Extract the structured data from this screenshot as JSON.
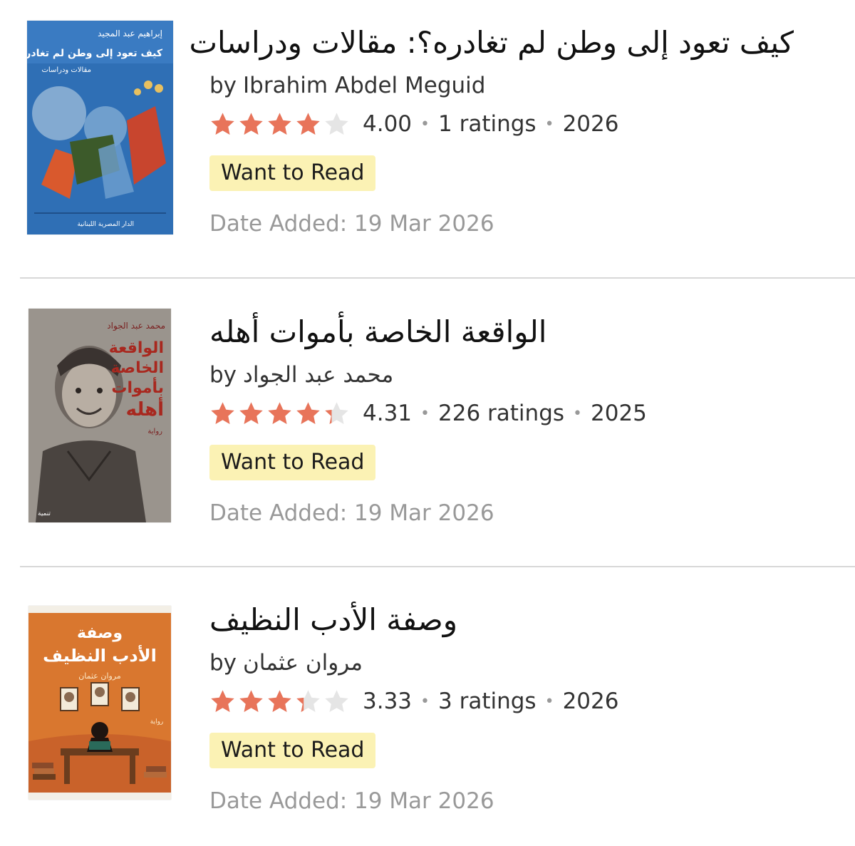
{
  "books": [
    {
      "title": "كيف تعود إلى وطن لم تغادره؟: مقالات ودراسات",
      "by_label": "by",
      "author": "Ibrahim Abdel Meguid",
      "rating": 4.0,
      "average": "4.00",
      "ratings_count": "1 ratings",
      "year": "2026",
      "shelf_button": "Want to Read",
      "date_added": "Date Added: 19 Mar 2026",
      "cover": {
        "top_text": "إبراهيم عبد المجيد",
        "title_text": "كيف تعود إلى وطن لم تغادره؟",
        "subtitle_text": "مقالات ودراسات",
        "publisher_text": "الدار المصرية اللبنانية",
        "bg_color": "#2f6fb5"
      }
    },
    {
      "title": "الواقعة الخاصة بأموات أهله",
      "by_label": "by",
      "author": "محمد عبد الجواد",
      "rating": 4.31,
      "average": "4.31",
      "ratings_count": "226 ratings",
      "year": "2025",
      "shelf_button": "Want to Read",
      "date_added": "Date Added: 19 Mar 2026",
      "cover": {
        "top_text": "محمد عبد الجواد",
        "title_line1": "الواقعة",
        "title_line2": "الخاصة",
        "title_line3": "بأموات",
        "title_line4": "أهله",
        "subtitle_text": "رواية",
        "publisher_text": "تنمية",
        "bg_color": "#8a8580"
      }
    },
    {
      "title": "وصفة الأدب النظيف",
      "by_label": "by",
      "author": "مروان عثمان",
      "rating": 3.33,
      "average": "3.33",
      "ratings_count": "3 ratings",
      "year": "2026",
      "shelf_button": "Want to Read",
      "date_added": "Date Added: 19 Mar 2026",
      "cover": {
        "title_line1": "وصفة",
        "title_line2": "الأدب النظيف",
        "top_text": "مروان عثمان",
        "subtitle_text": "رواية",
        "bg_color": "#d9772f"
      }
    }
  ],
  "colors": {
    "star_filled": "#e8745a",
    "star_empty": "#e5e5e5",
    "button_bg": "#fbf2b4",
    "divider": "#d8d8d8",
    "date_text": "#999999"
  },
  "icons": {
    "rating_star": "star-icon"
  }
}
